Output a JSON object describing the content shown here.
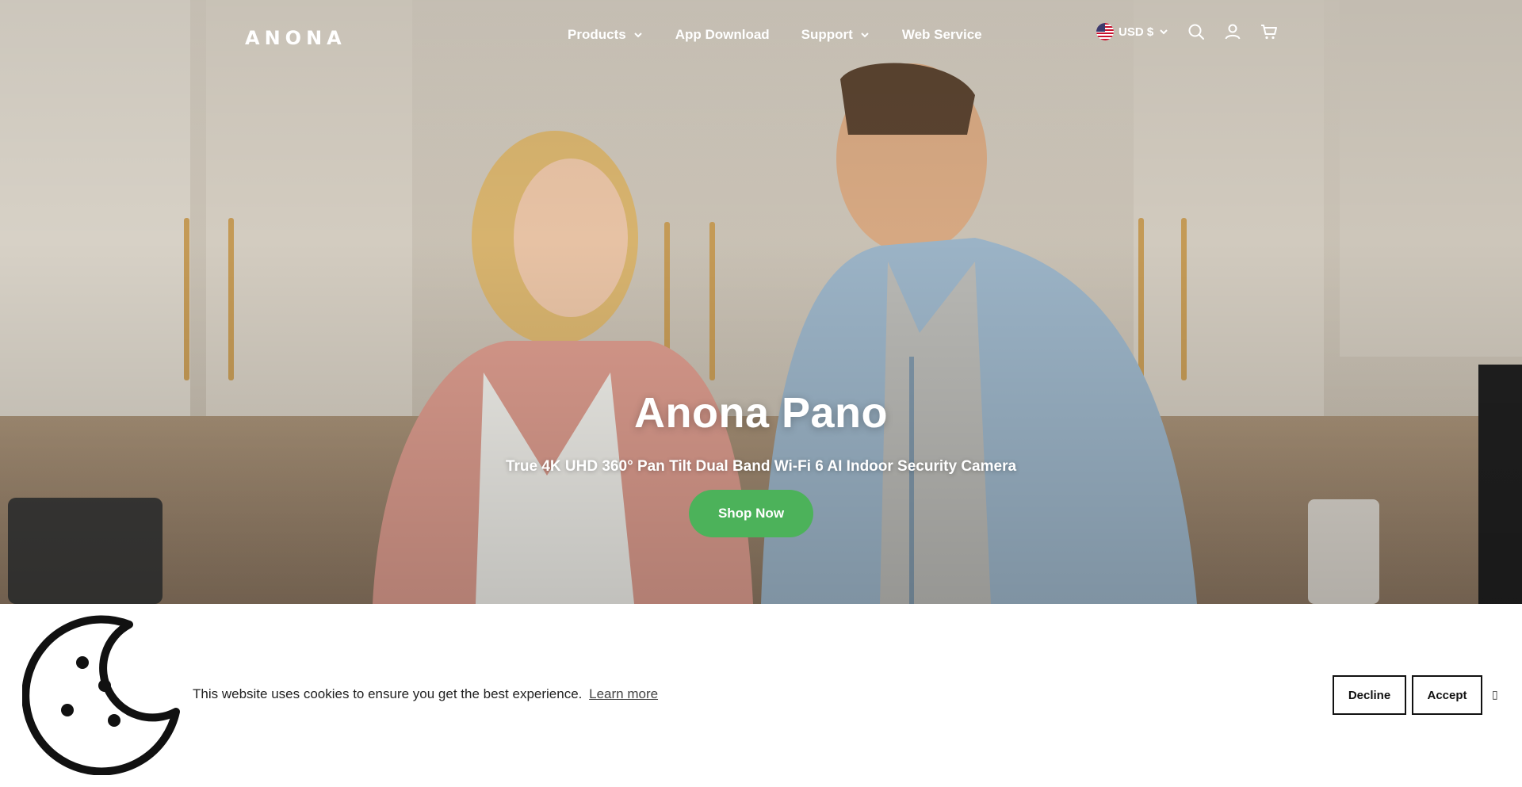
{
  "header": {
    "logo": "ANONA",
    "nav": [
      {
        "label": "Products",
        "has_dropdown": true
      },
      {
        "label": "App Download",
        "has_dropdown": false
      },
      {
        "label": "Support",
        "has_dropdown": true
      },
      {
        "label": "Web Service",
        "has_dropdown": false
      }
    ],
    "currency": "USD $",
    "icons": [
      "us-flag-icon",
      "search-icon",
      "account-icon",
      "cart-icon"
    ]
  },
  "hero": {
    "title": "Anona Pano",
    "subtitle": "True 4K UHD 360° Pan Tilt Dual Band Wi-Fi 6 AI Indoor Security Camera",
    "cta_label": "Shop Now",
    "cta_color": "#4cb25a"
  },
  "cookie_banner": {
    "message": "This website uses cookies to ensure you get the best experience.",
    "learn_more": "Learn more",
    "decline_label": "Decline",
    "accept_label": "Accept",
    "close_glyph": "▯"
  }
}
